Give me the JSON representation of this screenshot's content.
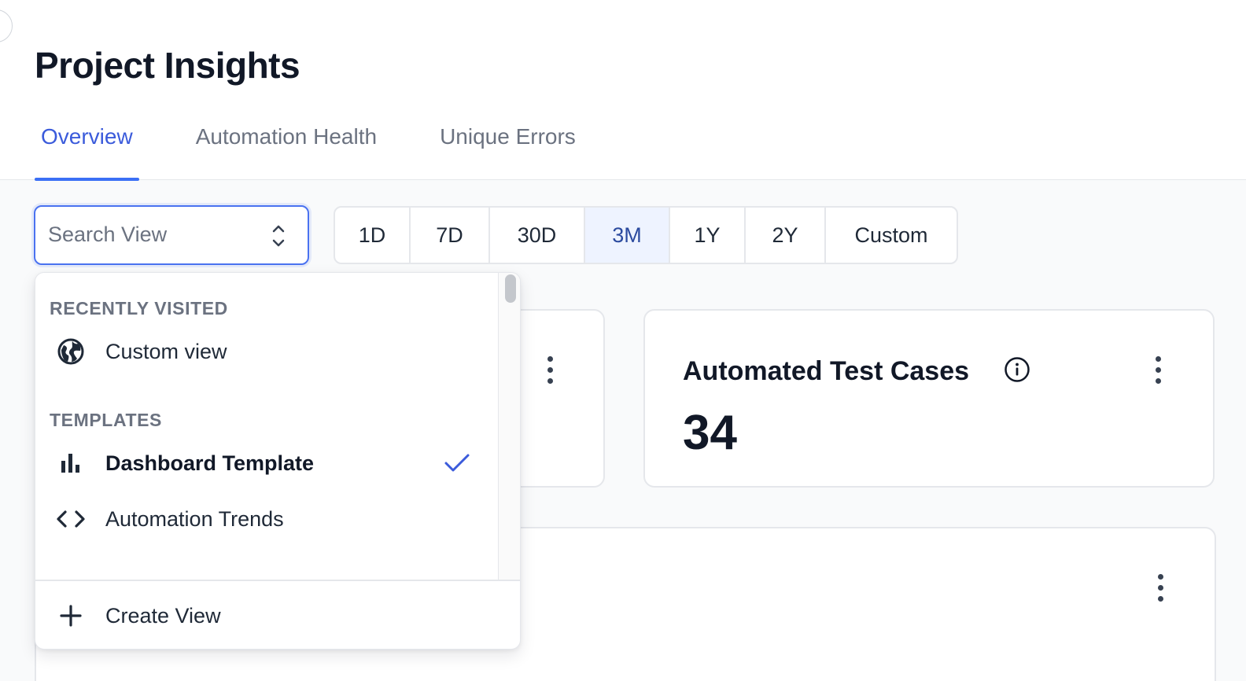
{
  "page": {
    "title": "Project Insights"
  },
  "tabs": [
    {
      "label": "Overview",
      "active": true
    },
    {
      "label": "Automation Health",
      "active": false
    },
    {
      "label": "Unique Errors",
      "active": false
    }
  ],
  "search": {
    "placeholder": "Search View",
    "value": ""
  },
  "time_ranges": [
    {
      "label": "1D",
      "active": false
    },
    {
      "label": "7D",
      "active": false
    },
    {
      "label": "30D",
      "active": false
    },
    {
      "label": "3M",
      "active": true
    },
    {
      "label": "1Y",
      "active": false
    },
    {
      "label": "2Y",
      "active": false
    },
    {
      "label": "Custom",
      "active": false
    }
  ],
  "dropdown": {
    "sections": [
      {
        "title": "RECENTLY VISITED",
        "items": [
          {
            "label": "Custom view",
            "icon": "globe-icon",
            "selected": false
          }
        ]
      },
      {
        "title": "TEMPLATES",
        "items": [
          {
            "label": "Dashboard Template",
            "icon": "bar-chart-icon",
            "selected": true
          },
          {
            "label": "Automation Trends",
            "icon": "code-icon",
            "selected": false
          }
        ]
      }
    ],
    "footer": {
      "label": "Create View",
      "icon": "plus-icon"
    }
  },
  "cards": {
    "automated_test_cases": {
      "title": "Automated Test Cases",
      "value": "34"
    }
  },
  "colors": {
    "accent": "#3b5bdb",
    "active_range_bg": "#eef3ff"
  }
}
